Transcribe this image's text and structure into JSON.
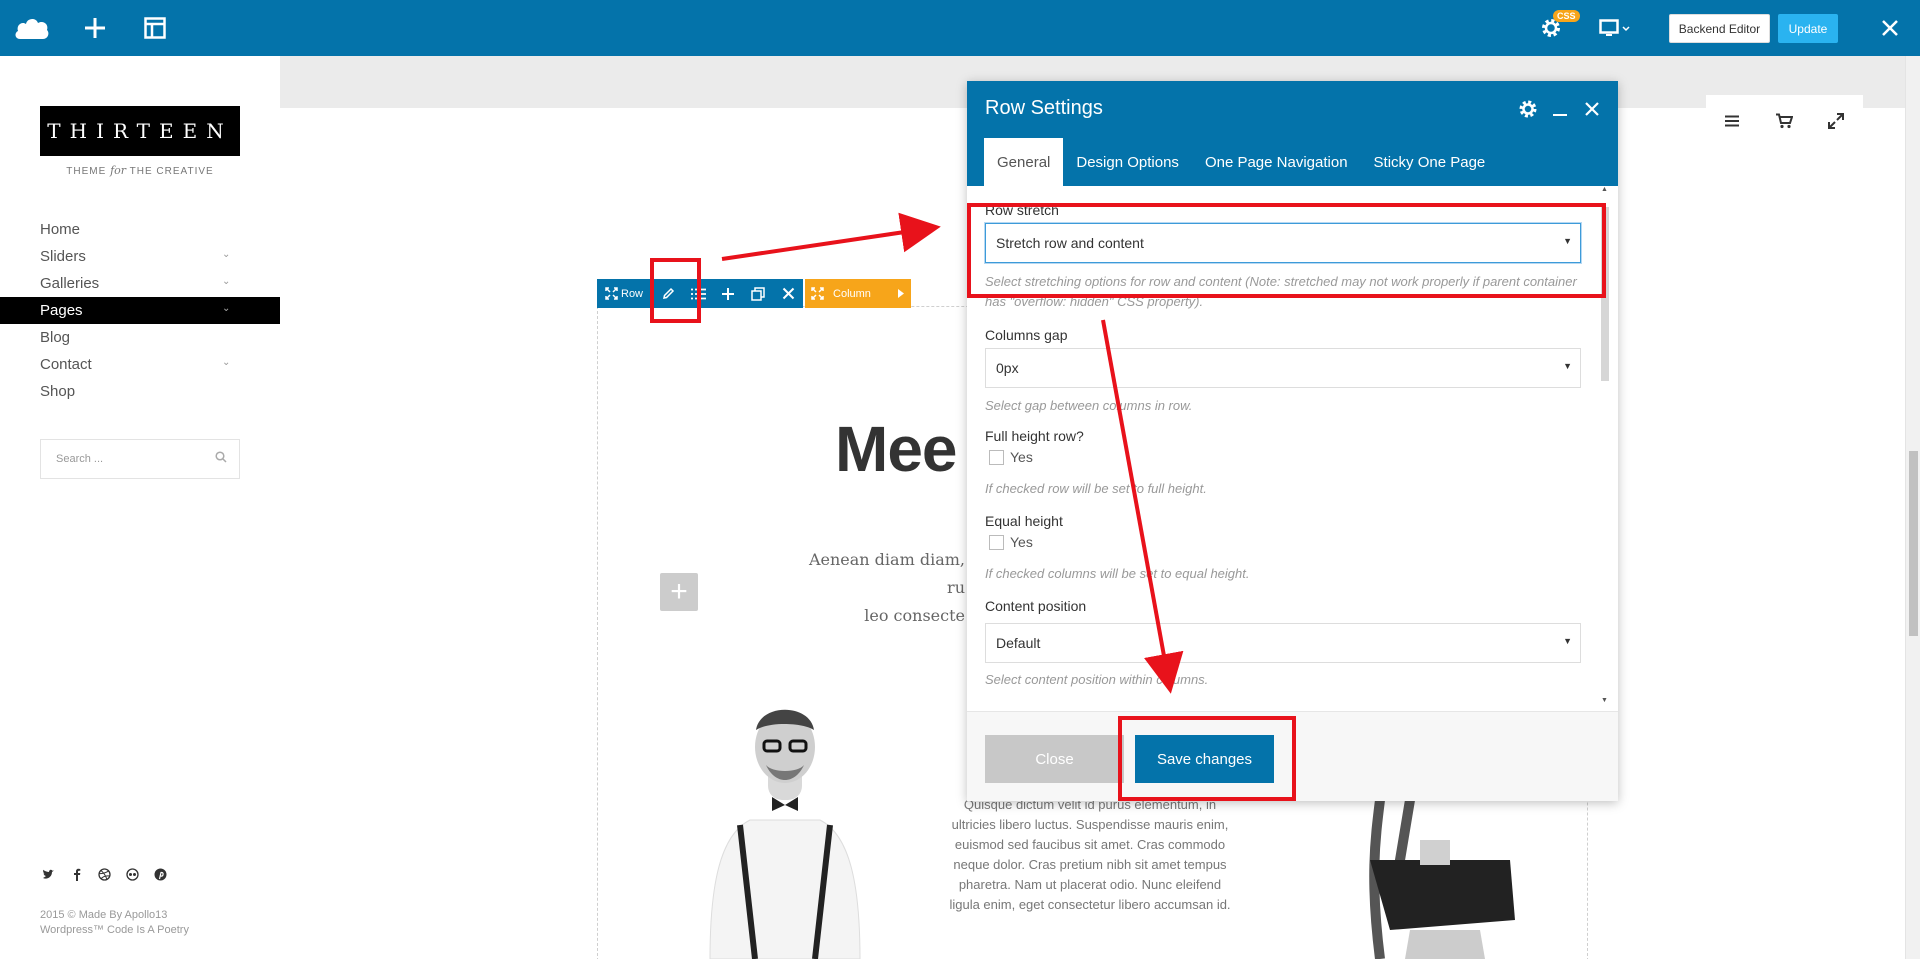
{
  "toolbar": {
    "css_badge": "CSS",
    "backend_editor_label": "Backend Editor",
    "update_label": "Update",
    "icons": [
      "logo-icon",
      "add-element-icon",
      "templates-icon",
      "page-settings-icon",
      "responsive-view-icon",
      "close-icon"
    ]
  },
  "sidebar": {
    "logo_text": "THIRTEEN",
    "tagline_before": "THEME",
    "tagline_italic": "for",
    "tagline_after": "THE CREATIVE",
    "menu": [
      {
        "label": "Home"
      },
      {
        "label": "Sliders"
      },
      {
        "label": "Galleries"
      },
      {
        "label": "Pages"
      },
      {
        "label": "Blog"
      },
      {
        "label": "Contact"
      },
      {
        "label": "Shop"
      }
    ],
    "active_item": "Pages",
    "search_placeholder": "Search ...",
    "copyright_line1": "2015 © Made By Apollo13",
    "copyright_line2": "Wordpress™ Code Is A Poetry"
  },
  "canvas": {
    "row_label": "Row",
    "column_label": "Column",
    "heading": "Mee",
    "lead_line1": "Aenean diam diam, ru",
    "lead_line2": "leo consecte",
    "body_text": [
      "Quisque dictum velit id purus elementum, in",
      "ultricies libero luctus. Suspendisse mauris enim,",
      "euismod sed faucibus sit amet. Cras commodo",
      "neque dolor. Cras pretium nibh sit amet tempus",
      "pharetra. Nam ut placerat odio. Nunc eleifend",
      "ligula enim, eget consectetur libero accumsan id."
    ]
  },
  "dialog": {
    "title": "Row Settings",
    "tabs": [
      {
        "label": "General",
        "active": true
      },
      {
        "label": "Design Options",
        "active": false
      },
      {
        "label": "One Page Navigation",
        "active": false
      },
      {
        "label": "Sticky One Page",
        "active": false
      }
    ],
    "fields": {
      "row_stretch": {
        "label": "Row stretch",
        "value": "Stretch row and content",
        "hint": "Select stretching options for row and content (Note: stretched may not work properly if parent container has \"overflow: hidden\" CSS property)."
      },
      "columns_gap": {
        "label": "Columns gap",
        "value": "0px",
        "hint": "Select gap between columns in row."
      },
      "full_height": {
        "label": "Full height row?",
        "option": "Yes",
        "checked": false,
        "hint": "If checked row will be set to full height."
      },
      "equal_height": {
        "label": "Equal height",
        "option": "Yes",
        "checked": false,
        "hint": "If checked columns will be set to equal height."
      },
      "content_position": {
        "label": "Content position",
        "value": "Default",
        "hint": "Select content position within columns."
      }
    },
    "close_label": "Close",
    "save_label": "Save changes"
  },
  "colors": {
    "toolbar_blue": "#0473aa",
    "update_blue": "#2ab3f0",
    "column_orange": "#f7a51a",
    "annotation_red": "#e8121b"
  }
}
